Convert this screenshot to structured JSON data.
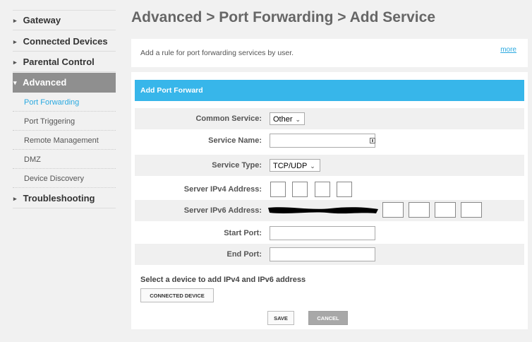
{
  "sidebar": {
    "items": [
      {
        "label": "Gateway"
      },
      {
        "label": "Connected Devices"
      },
      {
        "label": "Parental Control"
      },
      {
        "label": "Advanced"
      },
      {
        "label": "Troubleshooting"
      }
    ],
    "sub_items": [
      {
        "label": "Port Forwarding"
      },
      {
        "label": "Port Triggering"
      },
      {
        "label": "Remote Management"
      },
      {
        "label": "DMZ"
      },
      {
        "label": "Device Discovery"
      }
    ]
  },
  "page_title": "Advanced > Port Forwarding > Add Service",
  "description": {
    "text": "Add a rule for port forwarding services by user.",
    "more": "more"
  },
  "form": {
    "header": "Add Port Forward",
    "common_service": {
      "label": "Common Service:",
      "value": "Other"
    },
    "service_name": {
      "label": "Service Name:",
      "value": ""
    },
    "service_type": {
      "label": "Service Type:",
      "value": "TCP/UDP"
    },
    "ipv4": {
      "label": "Server IPv4 Address:"
    },
    "ipv6": {
      "label": "Server IPv6 Address:"
    },
    "start_port": {
      "label": "Start Port:",
      "value": ""
    },
    "end_port": {
      "label": "End Port:",
      "value": ""
    },
    "note": "Select a device to add IPv4 and IPv6 address",
    "connected_device_button": "CONNECTED DEVICE",
    "save_button": "SAVE",
    "cancel_button": "CANCEL"
  },
  "colors": {
    "accent": "#37b6ea",
    "active_nav": "#8f8f8f",
    "link": "#2aa9e0"
  },
  "icons": {
    "nav_arrow": "chevron-right-icon",
    "nav_open": "chevron-down-icon",
    "dropdown": "chevron-down-icon",
    "field_action": "keyboard-icon"
  }
}
